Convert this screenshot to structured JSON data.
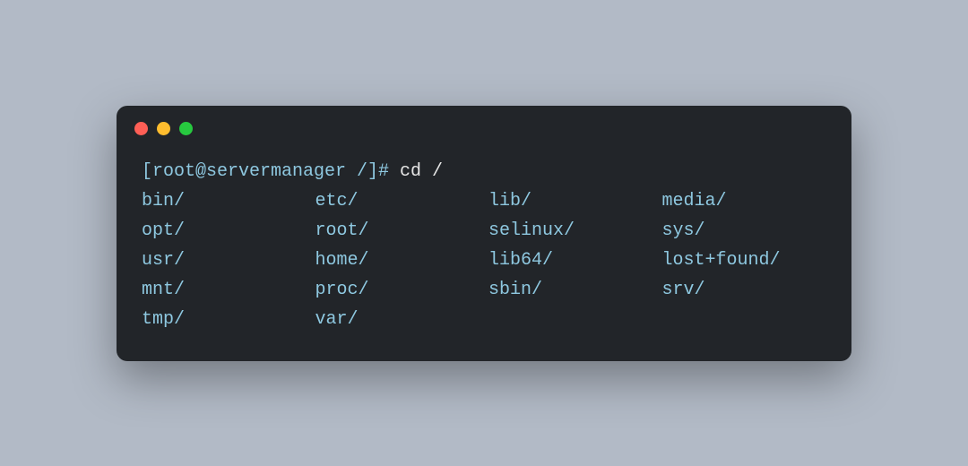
{
  "prompt": {
    "text": "[root@servermanager /]# ",
    "command": "cd /"
  },
  "listing": {
    "rows": [
      [
        "bin/",
        "etc/",
        "lib/",
        "media/"
      ],
      [
        "opt/",
        "root/",
        "selinux/",
        "sys/"
      ],
      [
        "usr/",
        "home/",
        "lib64/",
        "lost+found/"
      ],
      [
        "mnt/",
        "proc/",
        "sbin/",
        "srv/"
      ],
      [
        "tmp/",
        "var/",
        "",
        ""
      ]
    ]
  }
}
